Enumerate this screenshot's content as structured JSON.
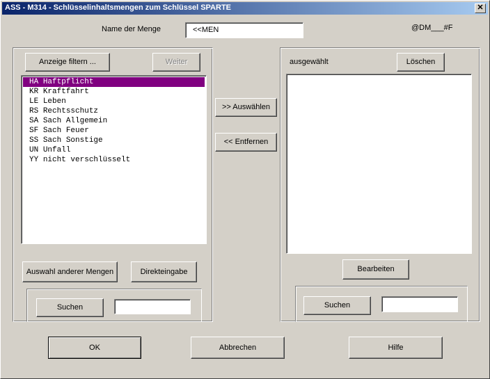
{
  "window": {
    "title": "ASS - M314 - Schlüsselinhaltsmengen zum Schlüssel SPARTE",
    "close_glyph": "✕"
  },
  "header": {
    "name_label": "Name der Menge",
    "name_value": "<<MEN",
    "code": "@DM___#F"
  },
  "left": {
    "filter_button": "Anzeige filtern ...",
    "next_button": "Weiter",
    "items": [
      {
        "code": "HA",
        "text": "Haftpflicht",
        "selected": true
      },
      {
        "code": "KR",
        "text": "Kraftfahrt",
        "selected": false
      },
      {
        "code": "LE",
        "text": "Leben",
        "selected": false
      },
      {
        "code": "RS",
        "text": "Rechtsschutz",
        "selected": false
      },
      {
        "code": "SA",
        "text": "Sach Allgemein",
        "selected": false
      },
      {
        "code": "SF",
        "text": "Sach Feuer",
        "selected": false
      },
      {
        "code": "SS",
        "text": "Sach Sonstige",
        "selected": false
      },
      {
        "code": "UN",
        "text": "Unfall",
        "selected": false
      },
      {
        "code": "YY",
        "text": "nicht verschlüsselt",
        "selected": false
      }
    ],
    "other_sets_button": "Auswahl anderer Mengen",
    "direct_input_button": "Direkteingabe",
    "search_button": "Suchen",
    "search_value": ""
  },
  "middle": {
    "select_button": ">> Auswählen",
    "remove_button": "<< Entfernen"
  },
  "right": {
    "selected_label": "ausgewählt",
    "delete_button": "Löschen",
    "edit_button": "Bearbeiten",
    "search_button": "Suchen",
    "search_value": ""
  },
  "footer": {
    "ok_button": "OK",
    "cancel_button": "Abbrechen",
    "help_button": "Hilfe"
  },
  "colors": {
    "face": "#d4d0c8",
    "selection": "#800080",
    "title_start": "#0a246a",
    "title_end": "#a6caf0"
  }
}
